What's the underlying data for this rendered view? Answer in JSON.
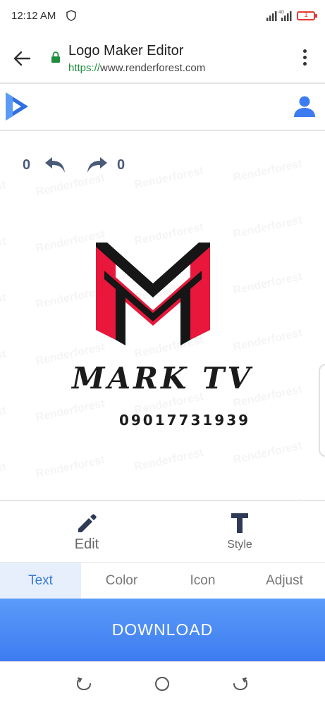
{
  "status": {
    "time": "12:12 AM",
    "network": "4G",
    "battery_badge": "1"
  },
  "browser": {
    "title": "Logo Maker Editor",
    "url_scheme": "https://",
    "url_host": "www.renderforest.com"
  },
  "canvas": {
    "undo_count": "0",
    "redo_count": "0",
    "watermark": "Renderforest",
    "brand_name": "MARK TV",
    "phone": "09017731939",
    "colors": {
      "mark_red": "#e8173b",
      "mark_black": "#161616"
    }
  },
  "toolbar": {
    "edit_label": "Edit",
    "style_label": "Style"
  },
  "tabs": [
    {
      "label": "Text",
      "active": true
    },
    {
      "label": "Color",
      "active": false
    },
    {
      "label": "Icon",
      "active": false
    },
    {
      "label": "Adjust",
      "active": false
    }
  ],
  "download_label": "DOWNLOAD",
  "icons": [
    "back-icon",
    "lock-icon",
    "kebab-icon",
    "logo-icon",
    "user-icon",
    "undo-icon",
    "redo-icon",
    "pencil-icon",
    "text-style-icon"
  ],
  "accent": "#3d7cf0"
}
